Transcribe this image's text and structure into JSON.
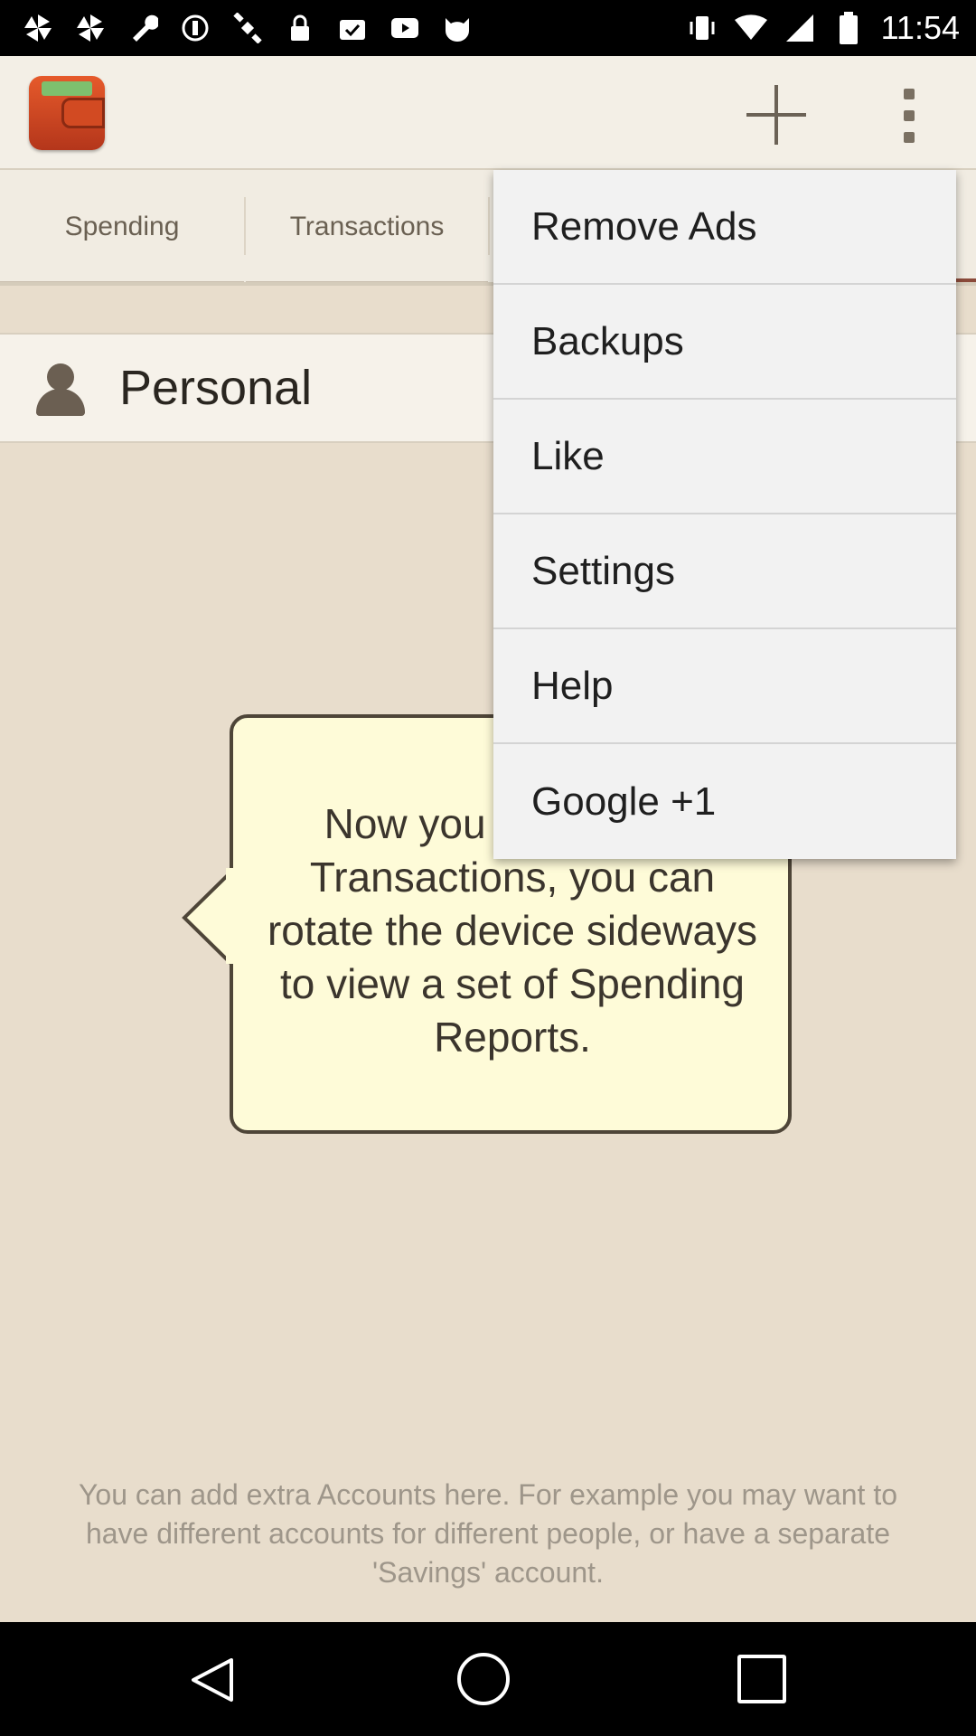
{
  "status_bar": {
    "time": "11:54"
  },
  "app_bar": {
    "add_icon": "plus-icon",
    "overflow_icon": "more-vert-icon"
  },
  "tabs": [
    {
      "label": "Spending"
    },
    {
      "label": "Transactions"
    }
  ],
  "account": {
    "name": "Personal"
  },
  "callout": {
    "text": "Now you have some Transactions, you can rotate the device sideways to view a set of Spending Reports."
  },
  "hint": {
    "text": "You can add extra Accounts here. For example you may want to have different accounts for different people, or have a separate 'Savings' account."
  },
  "menu": {
    "items": [
      {
        "label": "Remove Ads"
      },
      {
        "label": "Backups"
      },
      {
        "label": "Like"
      },
      {
        "label": "Settings"
      },
      {
        "label": "Help"
      },
      {
        "label": "Google +1"
      }
    ]
  },
  "colors": {
    "tab_underline": "#8b4a3a",
    "callout_bg": "#fefbd8",
    "background": "#e8ddcc"
  }
}
